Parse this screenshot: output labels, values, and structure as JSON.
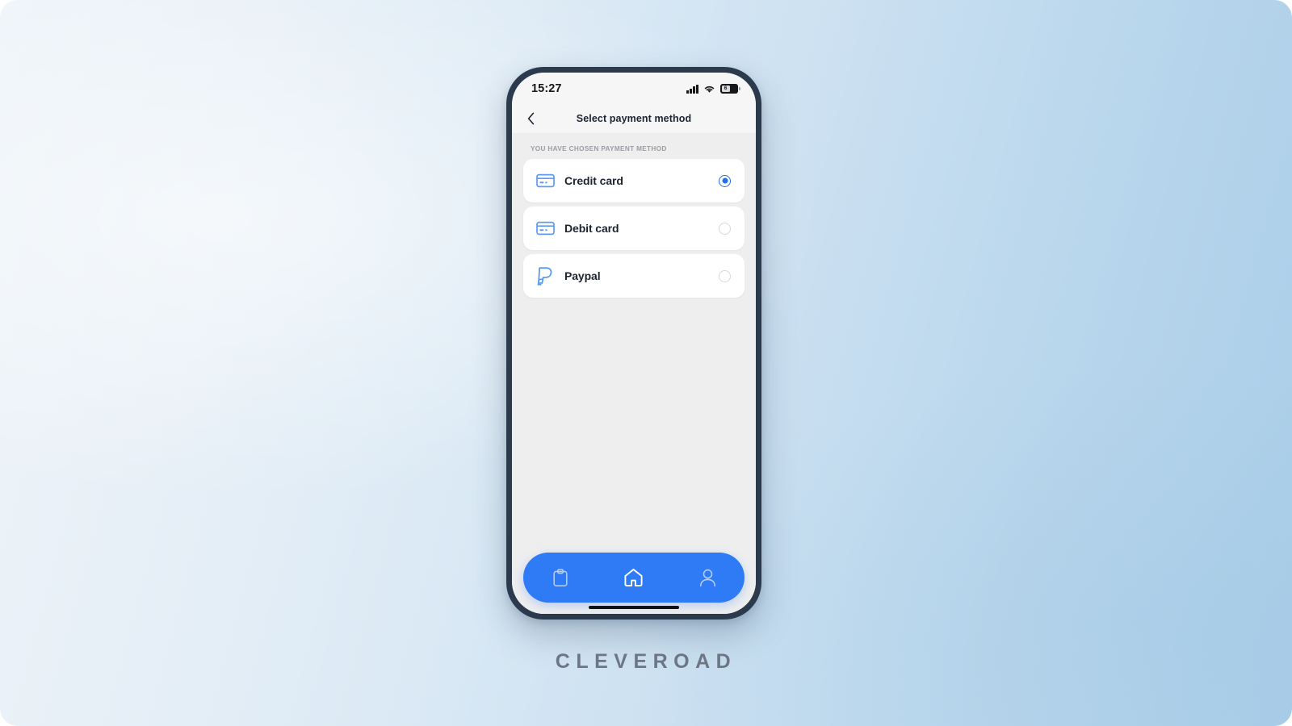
{
  "background": {
    "gradient_from": "#eef4f9",
    "gradient_to": "#a9cde8"
  },
  "phone": {
    "frame_color": "#2c3a4e",
    "screen_background": "#eeeeef"
  },
  "status_bar": {
    "time": "15:27",
    "signal_icon": "cellular-signal-icon",
    "wifi_icon": "wifi-icon",
    "battery_icon": "battery-icon",
    "battery_level": "6"
  },
  "nav_bar": {
    "back_icon": "chevron-left-icon",
    "title": "Select payment method"
  },
  "content": {
    "section_label": "YOU HAVE CHOSEN PAYMENT METHOD",
    "options": [
      {
        "id": "credit-card",
        "label": "Credit card",
        "icon": "credit-card-icon",
        "icon_color": "#5b9bf3",
        "selected": true
      },
      {
        "id": "debit-card",
        "label": "Debit card",
        "icon": "credit-card-icon",
        "icon_color": "#5b9bf3",
        "selected": false
      },
      {
        "id": "paypal",
        "label": "Paypal",
        "icon": "paypal-icon",
        "icon_color": "#5b9bf3",
        "selected": false
      }
    ],
    "accent_color": "#1f6fef"
  },
  "tab_bar": {
    "background_color": "#2f7bf6",
    "items": [
      {
        "id": "orders",
        "icon": "clipboard-icon",
        "active": false
      },
      {
        "id": "home",
        "icon": "home-icon",
        "active": true
      },
      {
        "id": "profile",
        "icon": "person-icon",
        "active": false
      }
    ]
  },
  "brand": {
    "name": "CLEVEROAD",
    "color": "#6d7685"
  }
}
